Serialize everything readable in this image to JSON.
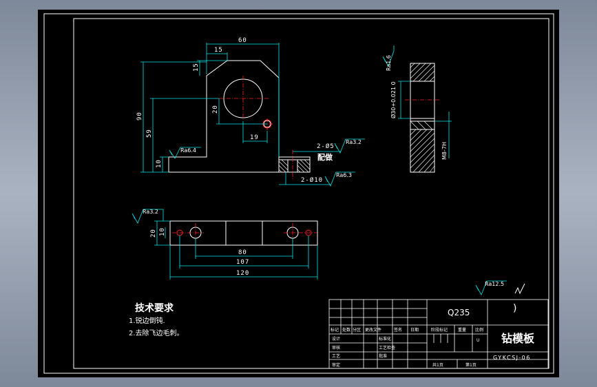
{
  "front_view": {
    "dims": {
      "top": "60",
      "notch": "15",
      "chamfer": "15",
      "height": "90",
      "hole_height": "59",
      "base": "10",
      "hole_offset": "20",
      "pin_offset": "19"
    },
    "roughness": {
      "base": "Ra6.4",
      "pin": "Ra3.2",
      "foot": "Ra6.3"
    },
    "holes": {
      "pin": "2-Ø5",
      "bolt": "2-Ø10"
    },
    "note": "配做"
  },
  "side_view": {
    "roughness": "Ra1.6",
    "bore": "Ø30+0.021 0",
    "thread": "M8-7H"
  },
  "top_view": {
    "roughness": "Ra3.2",
    "dims": {
      "thick_outer": "20",
      "thick_inner": "10",
      "hole_span": "80",
      "inner_span": "107",
      "length": "120"
    }
  },
  "general_roughness": "Ra12.5",
  "general_roughness_paren": ")",
  "tech_req": {
    "heading": "技术要求",
    "items": [
      "1.锐边倒钝.",
      "2.去除飞边毛刺。"
    ]
  },
  "title_block": {
    "material": "Q235",
    "name": "钻模板",
    "code": "GYKCSJ-06",
    "row_labels": [
      "标记",
      "处数",
      "分区",
      "更改文件",
      "签名",
      "日期"
    ],
    "roles": [
      "设计",
      "审核",
      "工艺",
      "审定"
    ],
    "std_label": "标准化",
    "tech_label": "工艺检查",
    "approve_label": "批准",
    "stage_label": "阶段标记",
    "weight_label": "重量",
    "scale_label": "比例",
    "stage_u": "U",
    "sheet_total": "共1页",
    "sheet_no": "第1页"
  }
}
